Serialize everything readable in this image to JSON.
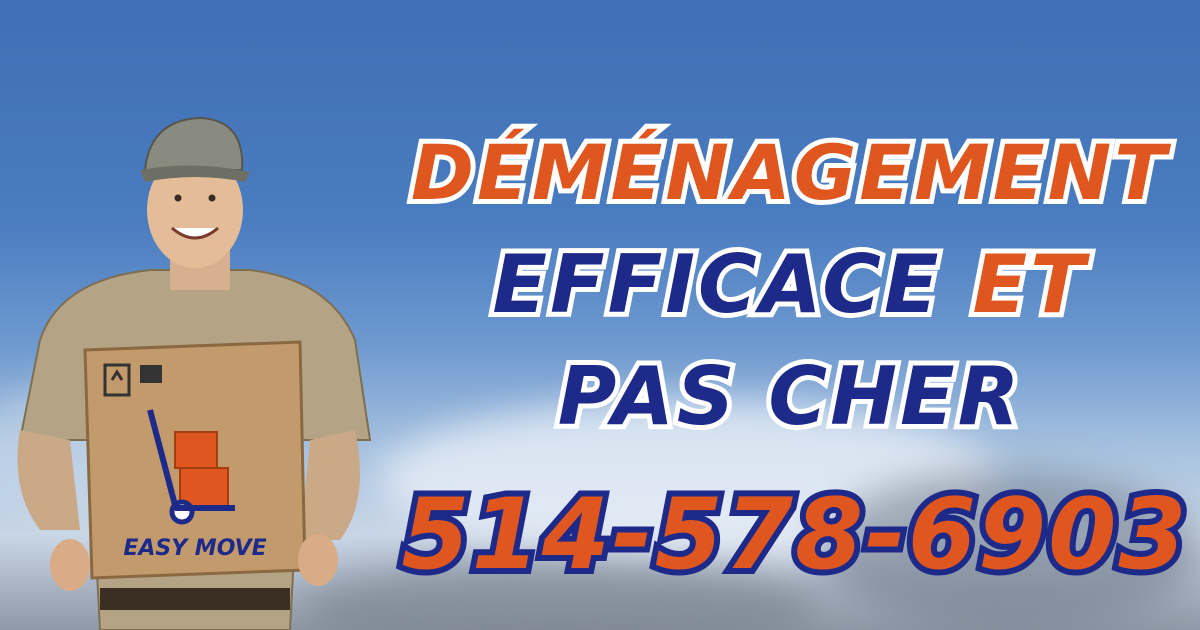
{
  "headline": {
    "line1": "DÉMÉNAGEMENT",
    "line2_word": "EFFICACE",
    "line2_et": "ET",
    "line3": "PAS CHER",
    "phone": "514-578-6903"
  },
  "box_label": "EASY MOVE",
  "colors": {
    "orange": "#e0561f",
    "navy": "#1e2a8a",
    "sky": "#4a7cc0"
  }
}
